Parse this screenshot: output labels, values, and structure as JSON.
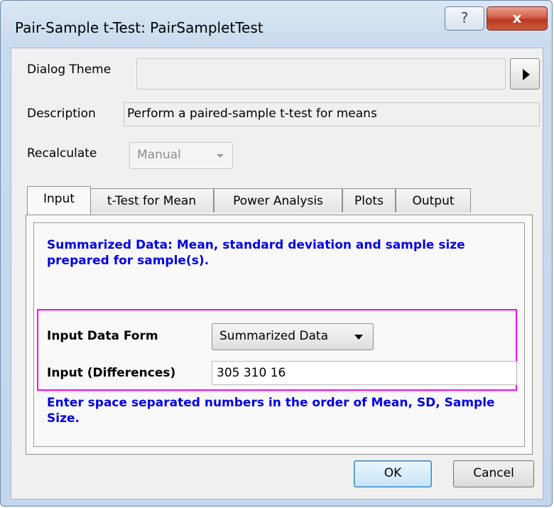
{
  "window": {
    "title": "Pair-Sample t-Test: PairSampletTest",
    "help_glyph": "?",
    "close_glyph": "x"
  },
  "dialog": {
    "theme_label": "Dialog Theme",
    "theme_value": "",
    "description_label": "Description",
    "description_value": "Perform a paired-sample t-test for means",
    "recalculate_label": "Recalculate",
    "recalculate_value": "Manual"
  },
  "tabs": [
    {
      "label": "Input",
      "active": true
    },
    {
      "label": "t-Test for Mean",
      "active": false
    },
    {
      "label": "Power Analysis",
      "active": false
    },
    {
      "label": "Plots",
      "active": false
    },
    {
      "label": "Output",
      "active": false
    }
  ],
  "input_tab": {
    "summary_note": "Summarized Data: Mean, standard deviation and sample size prepared for sample(s).",
    "data_form_label": "Input Data Form",
    "data_form_value": "Summarized Data",
    "differences_label": "Input (Differences)",
    "differences_value": "305 310 16",
    "hint_note": "Enter space separated numbers in the order of Mean, SD, Sample Size."
  },
  "buttons": {
    "ok": "OK",
    "cancel": "Cancel"
  },
  "colors": {
    "note_blue": "#0000e6",
    "highlight_magenta": "#ff00ff",
    "close_red": "#c8432a"
  }
}
